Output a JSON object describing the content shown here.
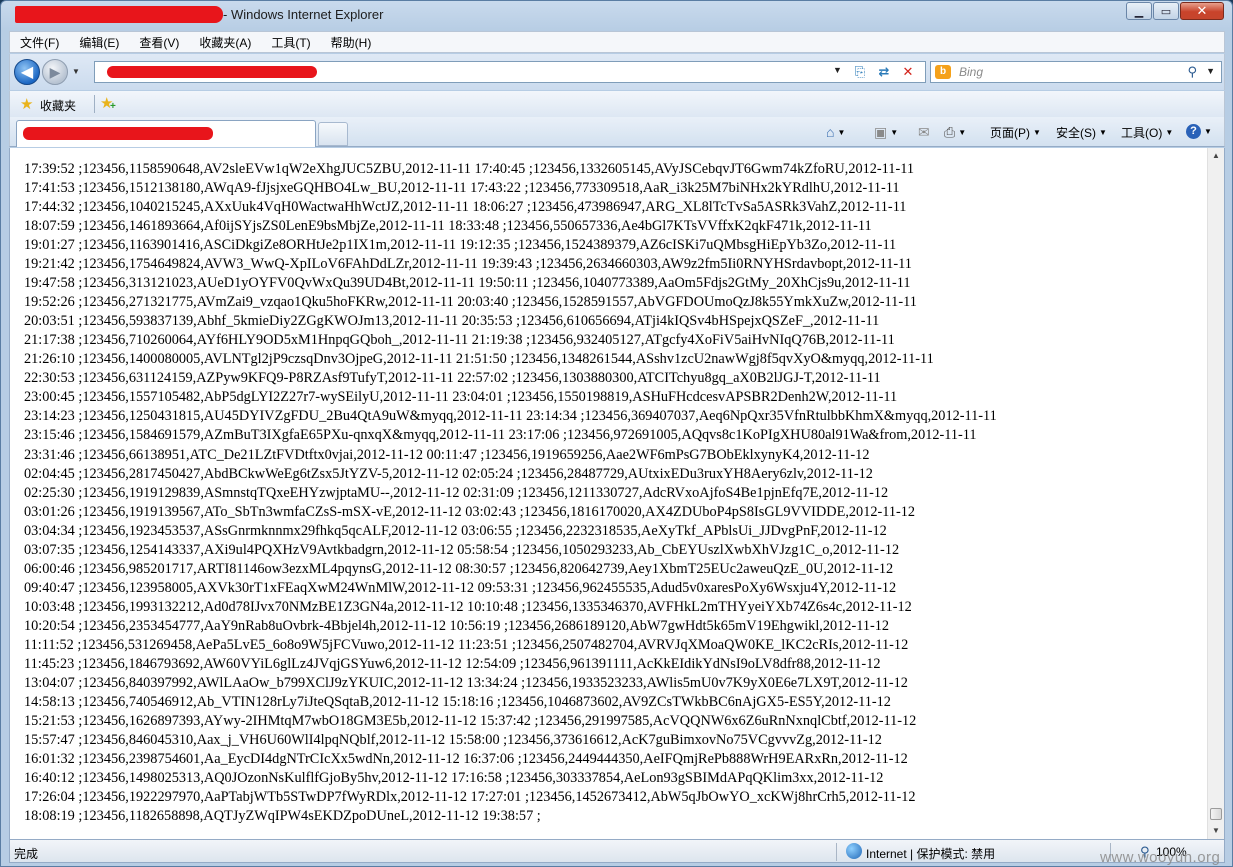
{
  "window": {
    "title_suffix": "- Windows Internet Explorer",
    "btn_minimize": "▁",
    "btn_maximize": "▭",
    "btn_close": "✕"
  },
  "menu": [
    "文件(F)",
    "编辑(E)",
    "查看(V)",
    "收藏夹(A)",
    "工具(T)",
    "帮助(H)"
  ],
  "search": {
    "placeholder": "Bing"
  },
  "favorites": {
    "label": "收藏夹"
  },
  "commands": {
    "page": "页面(P)",
    "safety": "安全(S)",
    "tools": "工具(O)"
  },
  "icons": {
    "back": "back-arrow-icon",
    "forward": "forward-arrow-icon",
    "compat": "compatibility-view-icon",
    "refresh": "refresh-icon",
    "stop": "stop-icon",
    "home": "home-icon",
    "feeds": "rss-feed-icon",
    "mail": "mail-icon",
    "print": "print-icon",
    "help": "help-icon"
  },
  "content_lines": [
    "17:39:52 ;123456,1158590648,AV2sleEVw1qW2eXhgJUC5ZBU,2012-11-11 17:40:45 ;123456,1332605145,AVyJSCebqvJT6Gwm74kZfoRU,2012-11-11",
    "17:41:53 ;123456,1512138180,AWqA9-fJjsjxeGQHBO4Lw_BU,2012-11-11 17:43:22 ;123456,773309518,AaR_i3k25M7biNHx2kYRdlhU,2012-11-11",
    "17:44:32 ;123456,1040215245,AXxUuk4VqH0WactwaHhWctJZ,2012-11-11 18:06:27 ;123456,473986947,ARG_XL8lTcTvSa5ASRk3VahZ,2012-11-11",
    "18:07:59 ;123456,1461893664,Af0ijSYjsZS0LenE9bsMbjZe,2012-11-11 18:33:48 ;123456,550657336,Ae4bGl7KTsVVffxK2qkF471k,2012-11-11",
    "19:01:27 ;123456,1163901416,ASCiDkgiZe8ORHtJe2p1IX1m,2012-11-11 19:12:35 ;123456,1524389379,AZ6cISKi7uQMbsgHiEpYb3Zo,2012-11-11",
    "19:21:42 ;123456,1754649824,AVW3_WwQ-XpILoV6FAhDdLZr,2012-11-11 19:39:43 ;123456,2634660303,AW9z2fm5Ii0RNYHSrdavbopt,2012-11-11",
    "19:47:58 ;123456,313121023,AUeD1yOYFV0QvWxQu39UD4Bt,2012-11-11 19:50:11 ;123456,1040773389,AaOm5Fdjs2GtMy_20XhCjs9u,2012-11-11",
    "19:52:26 ;123456,271321775,AVmZai9_vzqao1Qku5hoFKRw,2012-11-11 20:03:40 ;123456,1528591557,AbVGFDOUmoQzJ8k55YmkXuZw,2012-11-11",
    "20:03:51 ;123456,593837139,Abhf_5kmieDiy2ZGgKWOJm13,2012-11-11 20:35:53 ;123456,610656694,ATji4kIQSv4bHSpejxQSZeF_,2012-11-11",
    "21:17:38 ;123456,710260064,AYf6HLY9OD5xM1HnpqGQboh_,2012-11-11 21:19:38 ;123456,932405127,ATgcfy4XoFiV5aiHvNIqQ76B,2012-11-11",
    "21:26:10 ;123456,1400080005,AVLNTgl2jP9czsqDnv3OjpeG,2012-11-11 21:51:50 ;123456,1348261544,ASshv1zcU2nawWgj8f5qvXyO&myqq,2012-11-11",
    "22:30:53 ;123456,631124159,AZPyw9KFQ9-P8RZAsf9TufyT,2012-11-11 22:57:02 ;123456,1303880300,ATCITchyu8gq_aX0B2lJGJ-T,2012-11-11",
    "23:00:45 ;123456,1557105482,AbP5dgLYI2Z27r7-wySEilyU,2012-11-11 23:04:01 ;123456,1550198819,ASHuFHcdcesvAPSBR2Denh2W,2012-11-11",
    "23:14:23 ;123456,1250431815,AU45DYIVZgFDU_2Bu4QtA9uW&myqq,2012-11-11 23:14:34 ;123456,369407037,Aeq6NpQxr35VfnRtulbbKhmX&myqq,2012-11-11",
    "23:15:46 ;123456,1584691579,AZmBuT3IXgfaE65PXu-qnxqX&myqq,2012-11-11 23:17:06 ;123456,972691005,AQqvs8c1KoPIgXHU80al91Wa&from,2012-11-11",
    "23:31:46 ;123456,66138951,ATC_De21LZtFVDtftx0vjai,2012-11-12 00:11:47 ;123456,1919659256,Aae2WF6mPsG7BObEklxynyK4,2012-11-12",
    "02:04:45 ;123456,2817450427,AbdBCkwWeEg6tZsx5JtYZV-5,2012-11-12 02:05:24 ;123456,28487729,AUtxixEDu3ruxYH8Aery6zlv,2012-11-12",
    "02:25:30 ;123456,1919129839,ASmnstqTQxeEHYzwjptaMU--,2012-11-12 02:31:09 ;123456,1211330727,AdcRVxoAjfoS4Be1pjnEfq7E,2012-11-12",
    "03:01:26 ;123456,1919139567,ATo_SbTn3wmfaCZsS-mSX-vE,2012-11-12 03:02:43 ;123456,1816170020,AX4ZDUboP4pS8IsGL9VVIDDE,2012-11-12",
    "03:04:34 ;123456,1923453537,ASsGnrmknnmx29fhkq5qcALF,2012-11-12 03:06:55 ;123456,2232318535,AeXyTkf_APblsUi_JJDvgPnF,2012-11-12",
    "03:07:35 ;123456,1254143337,AXi9ul4PQXHzV9Avtkbadgrn,2012-11-12 05:58:54 ;123456,1050293233,Ab_CbEYUszlXwbXhVJzg1C_o,2012-11-12",
    "06:00:46 ;123456,985201717,ARTI81146ow3ezxML4pqynsG,2012-11-12 08:30:57 ;123456,820642739,Aey1XbmT25EUc2aweuQzE_0U,2012-11-12",
    "09:40:47 ;123456,123958005,AXVk30rT1xFEaqXwM24WnMlW,2012-11-12 09:53:31 ;123456,962455535,Adud5v0xaresPoXy6Wsxju4Y,2012-11-12",
    "10:03:48 ;123456,1993132212,Ad0d78IJvx70NMzBE1Z3GN4a,2012-11-12 10:10:48 ;123456,1335346370,AVFHkL2mTHYyeiYXb74Z6s4c,2012-11-12",
    "10:20:54 ;123456,2353454777,AaY9nRab8uOvbrk-4Bbjel4h,2012-11-12 10:56:19 ;123456,2686189120,AbW7gwHdt5k65mV19Ehgwikl,2012-11-12",
    "11:11:52 ;123456,531269458,AePa5LvE5_6o8o9W5jFCVuwo,2012-11-12 11:23:51 ;123456,2507482704,AVRVJqXMoaQW0KE_lKC2cRIs,2012-11-12",
    "11:45:23 ;123456,1846793692,AW60VYiL6glLz4JVqjGSYuw6,2012-11-12 12:54:09 ;123456,961391111,AcKkEIdikYdNsI9oLV8dfr88,2012-11-12",
    "13:04:07 ;123456,840397992,AWlLAaOw_b799XClJ9zYKUIC,2012-11-12 13:34:24 ;123456,1933523233,AWlis5mU0v7K9yX0E6e7LX9T,2012-11-12",
    "14:58:13 ;123456,740546912,Ab_VTIN128rLy7iJteQSqtaB,2012-11-12 15:18:16 ;123456,1046873602,AV9ZCsTWkbBC6nAjGX5-ES5Y,2012-11-12",
    "15:21:53 ;123456,1626897393,AYwy-2IHMtqM7wbO18GM3E5b,2012-11-12 15:37:42 ;123456,291997585,AcVQQNW6x6Z6uRnNxnqlCbtf,2012-11-12",
    "15:57:47 ;123456,846045310,Aax_j_VH6U60WlI4lpqNQblf,2012-11-12 15:58:00 ;123456,373616612,AcK7guBimxovNo75VCgvvvZg,2012-11-12",
    "16:01:32 ;123456,2398754601,Aa_EycDI4dgNTrCIcXx5wdNn,2012-11-12 16:37:06 ;123456,2449444350,AeIFQmjRePb888WrH9EARxRn,2012-11-12",
    "16:40:12 ;123456,1498025313,AQ0JOzonNsKulflfGjoBy5hv,2012-11-12 17:16:58 ;123456,303337854,AeLon93gSBIMdAPqQKlim3xx,2012-11-12",
    "17:26:04 ;123456,1922297970,AaPTabjWTb5STwDP7fWyRDlx,2012-11-12 17:27:01 ;123456,1452673412,AbW5qJbOwYO_xcKWj8hrCrh5,2012-11-12",
    "18:08:19 ;123456,1182658898,AQTJyZWqIPW4sEKDZpoDUneL,2012-11-12 19:38:57 ;"
  ],
  "status": {
    "text": "完成",
    "zone": "Internet | 保护模式: 禁用",
    "zoom": "100%"
  },
  "watermark": "www.wooyun.org"
}
